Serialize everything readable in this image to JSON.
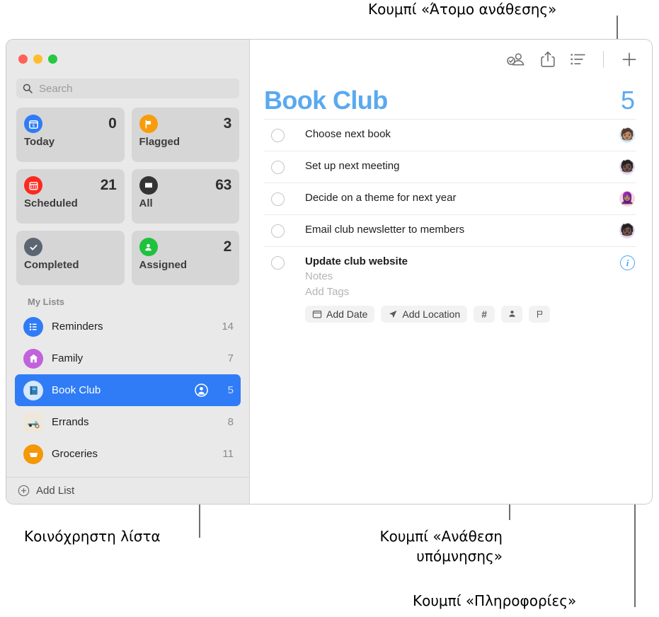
{
  "callouts": [
    {
      "id": "assignee",
      "text": "Κουμπί «Άτομο ανάθεσης»"
    },
    {
      "id": "shared-list",
      "text": "Κοινόχρηστη λίστα"
    },
    {
      "id": "assign-reminder-1",
      "text": "Κουμπί «Ανάθεση"
    },
    {
      "id": "assign-reminder-2",
      "text": "υπόμνησης»"
    },
    {
      "id": "info",
      "text": "Κουμπί «Πληροφορίες»"
    }
  ],
  "window": {
    "traffic_lights": [
      "close",
      "minimize",
      "zoom"
    ]
  },
  "sidebar": {
    "search": {
      "placeholder": "Search",
      "value": ""
    },
    "smart_lists": [
      {
        "label": "Today",
        "count": "0",
        "icon": "calendar-day-icon",
        "color": "#2f7cf6"
      },
      {
        "label": "Flagged",
        "count": "3",
        "icon": "flag-icon",
        "color": "#f79d0d"
      },
      {
        "label": "Scheduled",
        "count": "21",
        "icon": "calendar-icon",
        "color": "#fa2a21"
      },
      {
        "label": "All",
        "count": "63",
        "icon": "inbox-icon",
        "color": "#343434"
      },
      {
        "label": "Completed",
        "count": "",
        "icon": "checkmark-icon",
        "color": "#5b6672"
      },
      {
        "label": "Assigned",
        "count": "2",
        "icon": "person-icon",
        "color": "#1fc23d"
      }
    ],
    "mylists_header": "My Lists",
    "lists": [
      {
        "label": "Reminders",
        "count": "14",
        "icon": "bullet-list-icon",
        "color": "#2f7cf6",
        "selected": false,
        "shared": false
      },
      {
        "label": "Family",
        "count": "7",
        "icon": "house-icon",
        "color": "#c162dc",
        "selected": false,
        "shared": false
      },
      {
        "label": "Book Club",
        "count": "5",
        "icon": "book-icon",
        "color": "#d6e8fb",
        "selected": true,
        "shared": true
      },
      {
        "label": "Errands",
        "count": "8",
        "icon": "truck-icon",
        "color": "#efe7da",
        "selected": false,
        "shared": false
      },
      {
        "label": "Groceries",
        "count": "11",
        "icon": "basket-icon",
        "color": "#f59806",
        "selected": false,
        "shared": false
      }
    ],
    "add_list_label": "Add List"
  },
  "toolbar": {
    "buttons": [
      {
        "name": "assignee-button",
        "icon": "person-badge-checkmark-icon"
      },
      {
        "name": "share-button",
        "icon": "share-icon"
      },
      {
        "name": "view-options-button",
        "icon": "list-view-icon"
      },
      {
        "name": "add-reminder-button",
        "icon": "plus-icon"
      }
    ]
  },
  "main": {
    "title": "Book Club",
    "count": "5",
    "accent_color": "#5aa9f0",
    "tasks": [
      {
        "title": "Choose next book",
        "avatar": "🧑🏽",
        "avatar_bg": "#cfeaf8",
        "expanded": false
      },
      {
        "title": "Set up next meeting",
        "avatar": "🧑🏿",
        "avatar_bg": "#e2d8ef",
        "expanded": false
      },
      {
        "title": "Decide on a theme for next year",
        "avatar": "🧕🏽",
        "avatar_bg": "#f9d4e3",
        "expanded": false
      },
      {
        "title": "Email club newsletter to members",
        "avatar": "🧑🏿",
        "avatar_bg": "#e2d8ef",
        "expanded": false
      },
      {
        "title": "Update club website",
        "avatar": "",
        "avatar_bg": "",
        "expanded": true
      }
    ],
    "detail": {
      "notes_placeholder": "Notes",
      "tags_placeholder": "Add Tags",
      "chips": [
        {
          "label": "Add Date",
          "icon": "calendar-icon",
          "icon_only": false
        },
        {
          "label": "Add Location",
          "icon": "location-icon",
          "icon_only": false
        },
        {
          "label": "#",
          "icon": "hashtag-icon",
          "icon_only": true
        },
        {
          "label": "",
          "icon": "person-icon",
          "icon_only": true
        },
        {
          "label": "",
          "icon": "flag-icon",
          "icon_only": true
        }
      ],
      "info_label": "i"
    }
  }
}
